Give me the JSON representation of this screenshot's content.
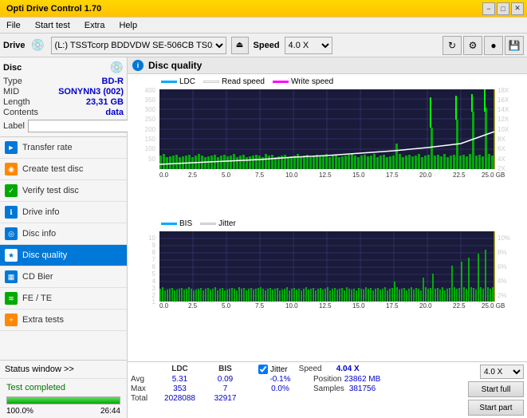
{
  "titlebar": {
    "title": "Opti Drive Control 1.70",
    "min_btn": "−",
    "max_btn": "□",
    "close_btn": "✕"
  },
  "menubar": {
    "items": [
      "File",
      "Start test",
      "Extra",
      "Help"
    ]
  },
  "drivebar": {
    "label": "Drive",
    "drive_value": "(L:)  TSSTcorp BDDVDW SE-506CB TS02",
    "speed_label": "Speed",
    "speed_value": "4.0 X"
  },
  "disc": {
    "title": "Disc",
    "type_label": "Type",
    "type_value": "BD-R",
    "mid_label": "MID",
    "mid_value": "SONYNN3 (002)",
    "length_label": "Length",
    "length_value": "23,31 GB",
    "contents_label": "Contents",
    "contents_value": "data",
    "label_label": "Label"
  },
  "nav": {
    "items": [
      {
        "id": "transfer-rate",
        "label": "Transfer rate",
        "icon": "►"
      },
      {
        "id": "create-test-disc",
        "label": "Create test disc",
        "icon": "◉"
      },
      {
        "id": "verify-test-disc",
        "label": "Verify test disc",
        "icon": "✓"
      },
      {
        "id": "drive-info",
        "label": "Drive info",
        "icon": "ℹ"
      },
      {
        "id": "disc-info",
        "label": "Disc info",
        "icon": "💿"
      },
      {
        "id": "disc-quality",
        "label": "Disc quality",
        "icon": "★",
        "active": true
      },
      {
        "id": "cd-bier",
        "label": "CD Bier",
        "icon": "▦"
      },
      {
        "id": "fe-te",
        "label": "FE / TE",
        "icon": "≋"
      },
      {
        "id": "extra-tests",
        "label": "Extra tests",
        "icon": "+"
      }
    ]
  },
  "status": {
    "window_label": "Status window >>",
    "completed_label": "Test completed",
    "progress": 100,
    "time": "26:44"
  },
  "chart": {
    "title": "Disc quality",
    "legend": {
      "ldc_label": "LDC",
      "read_label": "Read speed",
      "write_label": "Write speed",
      "bis_label": "BIS",
      "jitter_label": "Jitter"
    },
    "top": {
      "y_max": 400,
      "y_labels": [
        "400",
        "350",
        "300",
        "250",
        "200",
        "150",
        "100",
        "50"
      ],
      "y_right": [
        "18X",
        "16X",
        "14X",
        "12X",
        "10X",
        "8X",
        "6X",
        "4X",
        "2X"
      ],
      "x_labels": [
        "0.0",
        "2.5",
        "5.0",
        "7.5",
        "10.0",
        "12.5",
        "15.0",
        "17.5",
        "20.0",
        "22.5",
        "25.0 GB"
      ]
    },
    "bottom": {
      "y_labels": [
        "10",
        "9",
        "8",
        "7",
        "6",
        "5",
        "4",
        "3",
        "2",
        "1"
      ],
      "y_right": [
        "10%",
        "8%",
        "6%",
        "4%",
        "2%"
      ],
      "x_labels": [
        "0.0",
        "2.5",
        "5.0",
        "7.5",
        "10.0",
        "12.5",
        "15.0",
        "17.5",
        "20.0",
        "22.5",
        "25.0 GB"
      ]
    }
  },
  "stats": {
    "headers": [
      "LDC",
      "BIS",
      "",
      "Jitter",
      "Speed",
      "4.04 X"
    ],
    "avg_label": "Avg",
    "avg_ldc": "5.31",
    "avg_bis": "0.09",
    "avg_jitter": "-0.1%",
    "max_label": "Max",
    "max_ldc": "353",
    "max_bis": "7",
    "max_jitter": "0.0%",
    "total_label": "Total",
    "total_ldc": "2028088",
    "total_bis": "32917",
    "position_label": "Position",
    "position_value": "23862 MB",
    "samples_label": "Samples",
    "samples_value": "381756",
    "speed_label": "4.0 X",
    "start_full_label": "Start full",
    "start_part_label": "Start part",
    "jitter_checked": true
  }
}
